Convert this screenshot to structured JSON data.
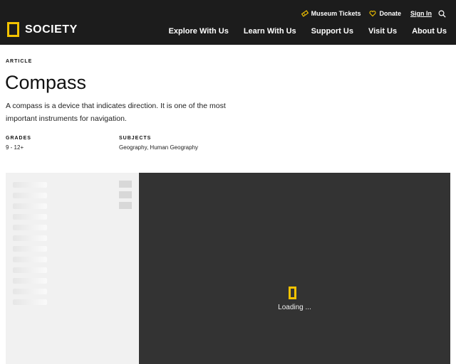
{
  "header": {
    "logo_text": "SOCIETY",
    "utility": {
      "museum_tickets": "Museum Tickets",
      "donate": "Donate",
      "sign_in": "Sign In"
    },
    "nav": [
      "Explore With Us",
      "Learn With Us",
      "Support Us",
      "Visit Us",
      "About Us"
    ]
  },
  "article": {
    "kicker": "ARTICLE",
    "title": "Compass",
    "description": "A compass is a device that indicates direction. It is one of the most important instruments for navigation.",
    "grades_label": "GRADES",
    "grades_value": "9 - 12+",
    "subjects_label": "SUBJECTS",
    "subjects_value": "Geography, Human Geography"
  },
  "viewer": {
    "loading_text": "Loading ..."
  },
  "colors": {
    "header_bg": "#1c1c1c",
    "brand_yellow": "#f2c200",
    "viewer_bg": "#333333"
  },
  "icons": [
    "ticket-icon",
    "heart-icon",
    "search-icon"
  ]
}
